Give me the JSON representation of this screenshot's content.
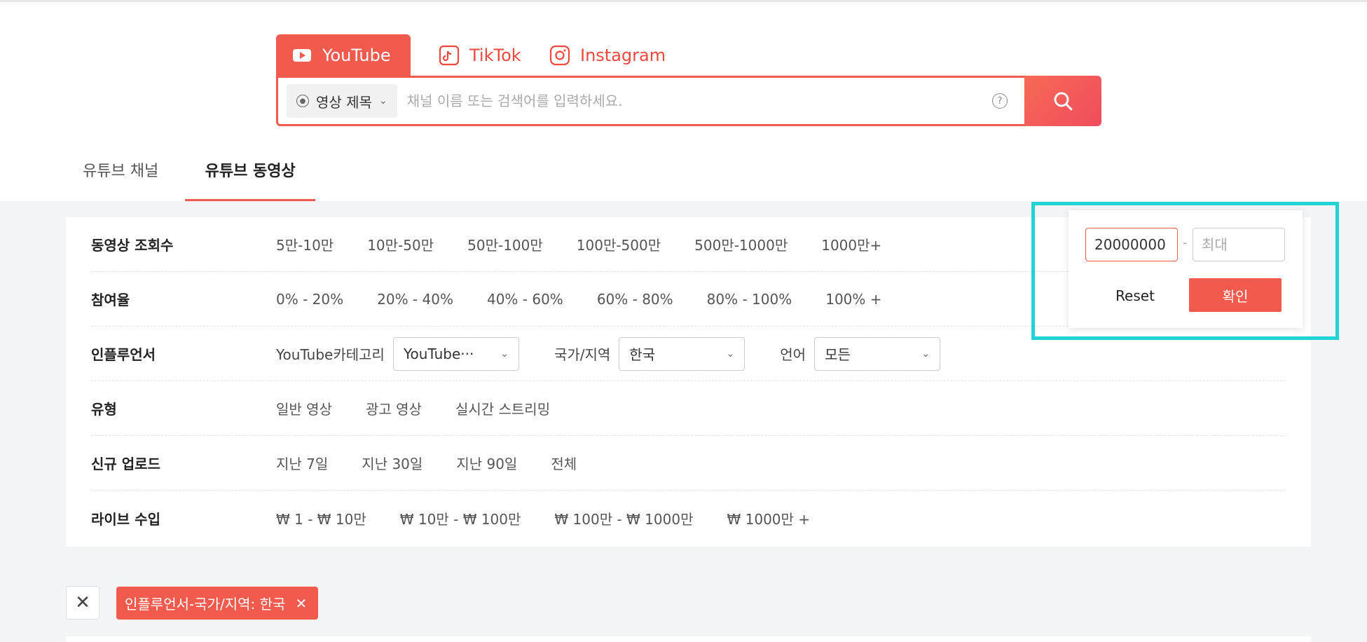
{
  "platform_tabs": [
    {
      "label": "YouTube",
      "icon": "youtube-icon"
    },
    {
      "label": "TikTok",
      "icon": "tiktok-icon"
    },
    {
      "label": "Instagram",
      "icon": "instagram-icon"
    }
  ],
  "search": {
    "type_label": "영상 제목",
    "placeholder": "채널 이름 또는 검색어를 입력하세요.",
    "help": "?"
  },
  "content_tabs": [
    "유튜브 채널",
    "유튜브 동영상"
  ],
  "filters": {
    "views": {
      "label": "동영상 조회수",
      "options": [
        "5만-10만",
        "10만-50만",
        "50만-100만",
        "100만-500만",
        "500만-1000만",
        "1000만+"
      ]
    },
    "engagement": {
      "label": "참여율",
      "options": [
        "0% - 20%",
        "20% - 40%",
        "40% - 60%",
        "60% - 80%",
        "80% - 100%",
        "100% +"
      ]
    },
    "influencer": {
      "label": "인플루언서",
      "category_label": "YouTube카테고리",
      "category_value": "YouTube···",
      "region_label": "국가/지역",
      "region_value": "한국",
      "language_label": "언어",
      "language_value": "모든"
    },
    "type": {
      "label": "유형",
      "options": [
        "일반 영상",
        "광고 영상",
        "실시간 스트리밍"
      ]
    },
    "upload": {
      "label": "신규 업로드",
      "options": [
        "지난 7일",
        "지난 30일",
        "지난 90일",
        "전체"
      ]
    },
    "live_revenue": {
      "label": "라이브 수입",
      "options": [
        "₩ 1 - ₩ 10만",
        "₩ 10만 - ₩ 100만",
        "₩ 100만 - ₩ 1000만",
        "₩ 1000만 +"
      ]
    }
  },
  "range_popover": {
    "min_value": "20000000",
    "dash": "-",
    "max_placeholder": "최대",
    "reset_label": "Reset",
    "confirm_label": "확인"
  },
  "active_chip": "인플루언서-국가/지역: 한국",
  "colors": {
    "accent": "#f25a4d",
    "highlight": "#22d3d6"
  }
}
